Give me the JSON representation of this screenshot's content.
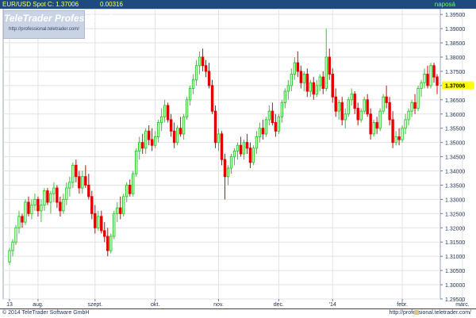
{
  "header": {
    "symbol_label": "EUR/USD Spot",
    "close_label": "C: 1.37006",
    "change_value": "0.00316",
    "interval_label": "naposá",
    "colors": {
      "bar": "#1d4b7f",
      "text": "#ffff66",
      "interval": "#66ff66"
    }
  },
  "logo": {
    "title": "TeleTrader Professional",
    "url": "http://professional.teletrader.com/"
  },
  "footer": {
    "copyright": "© 2014 TeleTrader Software GmbH",
    "url": "http://professional.teletrader.com/"
  },
  "chart_data": {
    "type": "candlestick",
    "ylim": [
      1.295,
      1.397
    ],
    "y_ticks": [
      "1.39500",
      "1.39000",
      "1.38500",
      "1.38000",
      "1.37500",
      "1.37000",
      "1.36500",
      "1.36000",
      "1.35500",
      "1.35000",
      "1.34500",
      "1.34000",
      "1.33500",
      "1.33000",
      "1.32500",
      "1.32000",
      "1.31500",
      "1.31000",
      "1.30500",
      "1.30000",
      "1.29500"
    ],
    "last_value": "1.37006",
    "x_tick_labels": [
      {
        "label": "13",
        "index": 0
      },
      {
        "label": "aug.",
        "index": 9
      },
      {
        "label": "szept.",
        "index": 27
      },
      {
        "label": "okt.",
        "index": 46
      },
      {
        "label": "nov.",
        "index": 66
      },
      {
        "label": "dec.",
        "index": 85
      },
      {
        "label": "'14",
        "index": 102
      },
      {
        "label": "febr.",
        "index": 124
      },
      {
        "label": "márc.",
        "index": 143
      }
    ],
    "colors": {
      "up": "#32c832",
      "down": "#e00000",
      "grid": "#e2e2e2",
      "last_value_bg": "#ffff00"
    },
    "grid": true,
    "ohlc": [
      [
        1.308,
        1.313,
        1.307,
        1.312
      ],
      [
        1.312,
        1.316,
        1.31,
        1.315
      ],
      [
        1.315,
        1.321,
        1.314,
        1.32
      ],
      [
        1.32,
        1.326,
        1.318,
        1.324
      ],
      [
        1.324,
        1.325,
        1.32,
        1.322
      ],
      [
        1.322,
        1.33,
        1.321,
        1.329
      ],
      [
        1.329,
        1.331,
        1.324,
        1.325
      ],
      [
        1.325,
        1.33,
        1.323,
        1.328
      ],
      [
        1.328,
        1.332,
        1.326,
        1.33
      ],
      [
        1.33,
        1.331,
        1.324,
        1.326
      ],
      [
        1.326,
        1.33,
        1.322,
        1.328
      ],
      [
        1.328,
        1.334,
        1.326,
        1.333
      ],
      [
        1.333,
        1.334,
        1.328,
        1.329
      ],
      [
        1.329,
        1.333,
        1.325,
        1.332
      ],
      [
        1.332,
        1.336,
        1.329,
        1.334
      ],
      [
        1.334,
        1.335,
        1.327,
        1.329
      ],
      [
        1.329,
        1.331,
        1.324,
        1.326
      ],
      [
        1.326,
        1.332,
        1.325,
        1.33
      ],
      [
        1.33,
        1.336,
        1.328,
        1.334
      ],
      [
        1.334,
        1.338,
        1.331,
        1.336
      ],
      [
        1.336,
        1.343,
        1.334,
        1.342
      ],
      [
        1.342,
        1.344,
        1.336,
        1.338
      ],
      [
        1.338,
        1.34,
        1.332,
        1.334
      ],
      [
        1.334,
        1.34,
        1.332,
        1.338
      ],
      [
        1.338,
        1.342,
        1.334,
        1.335
      ],
      [
        1.335,
        1.339,
        1.33,
        1.331
      ],
      [
        1.331,
        1.333,
        1.323,
        1.325
      ],
      [
        1.325,
        1.328,
        1.318,
        1.32
      ],
      [
        1.32,
        1.326,
        1.319,
        1.324
      ],
      [
        1.324,
        1.326,
        1.318,
        1.319
      ],
      [
        1.319,
        1.322,
        1.315,
        1.317
      ],
      [
        1.317,
        1.32,
        1.31,
        1.312
      ],
      [
        1.312,
        1.318,
        1.311,
        1.317
      ],
      [
        1.317,
        1.326,
        1.316,
        1.325
      ],
      [
        1.325,
        1.329,
        1.322,
        1.327
      ],
      [
        1.327,
        1.331,
        1.323,
        1.325
      ],
      [
        1.325,
        1.332,
        1.324,
        1.331
      ],
      [
        1.331,
        1.336,
        1.329,
        1.335
      ],
      [
        1.335,
        1.337,
        1.331,
        1.332
      ],
      [
        1.332,
        1.34,
        1.331,
        1.339
      ],
      [
        1.339,
        1.348,
        1.338,
        1.347
      ],
      [
        1.347,
        1.352,
        1.344,
        1.35
      ],
      [
        1.35,
        1.353,
        1.346,
        1.348
      ],
      [
        1.348,
        1.355,
        1.346,
        1.354
      ],
      [
        1.354,
        1.356,
        1.349,
        1.351
      ],
      [
        1.351,
        1.355,
        1.347,
        1.349
      ],
      [
        1.349,
        1.354,
        1.348,
        1.352
      ],
      [
        1.352,
        1.358,
        1.35,
        1.357
      ],
      [
        1.357,
        1.362,
        1.354,
        1.359
      ],
      [
        1.359,
        1.365,
        1.357,
        1.363
      ],
      [
        1.363,
        1.364,
        1.357,
        1.358
      ],
      [
        1.358,
        1.36,
        1.352,
        1.354
      ],
      [
        1.354,
        1.357,
        1.348,
        1.35
      ],
      [
        1.35,
        1.356,
        1.349,
        1.355
      ],
      [
        1.355,
        1.359,
        1.352,
        1.353
      ],
      [
        1.353,
        1.36,
        1.351,
        1.359
      ],
      [
        1.359,
        1.366,
        1.358,
        1.365
      ],
      [
        1.365,
        1.37,
        1.363,
        1.369
      ],
      [
        1.369,
        1.374,
        1.367,
        1.372
      ],
      [
        1.372,
        1.379,
        1.37,
        1.377
      ],
      [
        1.377,
        1.382,
        1.374,
        1.38
      ],
      [
        1.38,
        1.383,
        1.375,
        1.377
      ],
      [
        1.377,
        1.379,
        1.373,
        1.375
      ],
      [
        1.375,
        1.378,
        1.369,
        1.37
      ],
      [
        1.37,
        1.372,
        1.36,
        1.361
      ],
      [
        1.361,
        1.363,
        1.348,
        1.35
      ],
      [
        1.35,
        1.355,
        1.347,
        1.353
      ],
      [
        1.353,
        1.354,
        1.342,
        1.344
      ],
      [
        1.344,
        1.346,
        1.33,
        1.338
      ],
      [
        1.338,
        1.342,
        1.335,
        1.341
      ],
      [
        1.341,
        1.346,
        1.339,
        1.345
      ],
      [
        1.345,
        1.348,
        1.342,
        1.347
      ],
      [
        1.347,
        1.35,
        1.344,
        1.349
      ],
      [
        1.349,
        1.352,
        1.345,
        1.346
      ],
      [
        1.346,
        1.351,
        1.344,
        1.35
      ],
      [
        1.35,
        1.353,
        1.346,
        1.348
      ],
      [
        1.348,
        1.35,
        1.341,
        1.343
      ],
      [
        1.343,
        1.349,
        1.342,
        1.348
      ],
      [
        1.348,
        1.354,
        1.346,
        1.352
      ],
      [
        1.352,
        1.357,
        1.35,
        1.355
      ],
      [
        1.355,
        1.358,
        1.351,
        1.353
      ],
      [
        1.353,
        1.359,
        1.352,
        1.358
      ],
      [
        1.358,
        1.363,
        1.356,
        1.361
      ],
      [
        1.361,
        1.364,
        1.356,
        1.357
      ],
      [
        1.357,
        1.36,
        1.352,
        1.354
      ],
      [
        1.354,
        1.36,
        1.353,
        1.359
      ],
      [
        1.359,
        1.365,
        1.357,
        1.364
      ],
      [
        1.364,
        1.369,
        1.362,
        1.368
      ],
      [
        1.368,
        1.372,
        1.365,
        1.37
      ],
      [
        1.37,
        1.376,
        1.368,
        1.374
      ],
      [
        1.374,
        1.38,
        1.372,
        1.378
      ],
      [
        1.378,
        1.382,
        1.373,
        1.375
      ],
      [
        1.375,
        1.377,
        1.369,
        1.371
      ],
      [
        1.371,
        1.375,
        1.368,
        1.374
      ],
      [
        1.374,
        1.376,
        1.366,
        1.368
      ],
      [
        1.368,
        1.372,
        1.366,
        1.371
      ],
      [
        1.371,
        1.373,
        1.365,
        1.367
      ],
      [
        1.367,
        1.372,
        1.366,
        1.37
      ],
      [
        1.37,
        1.374,
        1.368,
        1.373
      ],
      [
        1.373,
        1.375,
        1.367,
        1.369
      ],
      [
        1.369,
        1.39,
        1.368,
        1.38
      ],
      [
        1.38,
        1.383,
        1.372,
        1.374
      ],
      [
        1.374,
        1.376,
        1.364,
        1.366
      ],
      [
        1.366,
        1.369,
        1.359,
        1.361
      ],
      [
        1.361,
        1.365,
        1.358,
        1.364
      ],
      [
        1.364,
        1.366,
        1.356,
        1.358
      ],
      [
        1.358,
        1.362,
        1.355,
        1.36
      ],
      [
        1.36,
        1.366,
        1.359,
        1.365
      ],
      [
        1.365,
        1.369,
        1.363,
        1.367
      ],
      [
        1.367,
        1.368,
        1.36,
        1.362
      ],
      [
        1.362,
        1.364,
        1.356,
        1.358
      ],
      [
        1.358,
        1.362,
        1.357,
        1.361
      ],
      [
        1.361,
        1.366,
        1.36,
        1.365
      ],
      [
        1.365,
        1.367,
        1.359,
        1.36
      ],
      [
        1.36,
        1.362,
        1.351,
        1.353
      ],
      [
        1.353,
        1.358,
        1.352,
        1.357
      ],
      [
        1.357,
        1.359,
        1.353,
        1.355
      ],
      [
        1.355,
        1.362,
        1.354,
        1.361
      ],
      [
        1.361,
        1.367,
        1.36,
        1.366
      ],
      [
        1.366,
        1.37,
        1.362,
        1.364
      ],
      [
        1.364,
        1.366,
        1.356,
        1.358
      ],
      [
        1.358,
        1.361,
        1.348,
        1.35
      ],
      [
        1.35,
        1.354,
        1.349,
        1.352
      ],
      [
        1.352,
        1.355,
        1.349,
        1.351
      ],
      [
        1.351,
        1.356,
        1.35,
        1.355
      ],
      [
        1.355,
        1.36,
        1.353,
        1.358
      ],
      [
        1.358,
        1.362,
        1.356,
        1.361
      ],
      [
        1.361,
        1.365,
        1.359,
        1.364
      ],
      [
        1.364,
        1.367,
        1.36,
        1.362
      ],
      [
        1.362,
        1.37,
        1.361,
        1.369
      ],
      [
        1.369,
        1.372,
        1.366,
        1.371
      ],
      [
        1.371,
        1.376,
        1.369,
        1.374
      ],
      [
        1.374,
        1.377,
        1.369,
        1.37
      ],
      [
        1.37,
        1.378,
        1.369,
        1.377
      ],
      [
        1.377,
        1.378,
        1.371,
        1.373
      ],
      [
        1.373,
        1.374,
        1.367,
        1.3701
      ]
    ]
  }
}
